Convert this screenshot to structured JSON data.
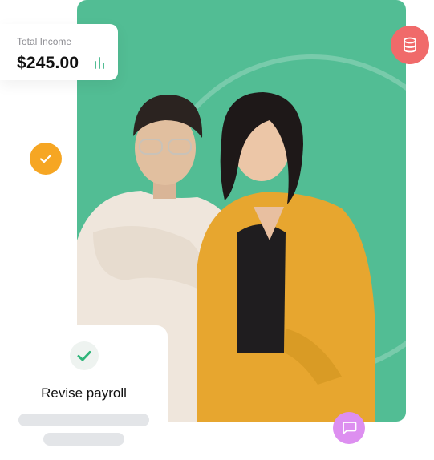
{
  "income": {
    "label": "Total Income",
    "value": "$245.00",
    "icon": "bar-chart-icon"
  },
  "task": {
    "title": "Revise payroll",
    "icon": "check-icon"
  },
  "badges": {
    "coins_icon": "coins-icon",
    "check_icon": "check-icon",
    "chat_icon": "chat-bubble-icon"
  },
  "colors": {
    "hero_bg": "#52bd94",
    "coins_bg": "#f06a6a",
    "check_bg": "#f6a623",
    "chat_bg": "#dd8ff0",
    "task_check": "#2fb57a",
    "skeleton": "#e3e5e8"
  }
}
